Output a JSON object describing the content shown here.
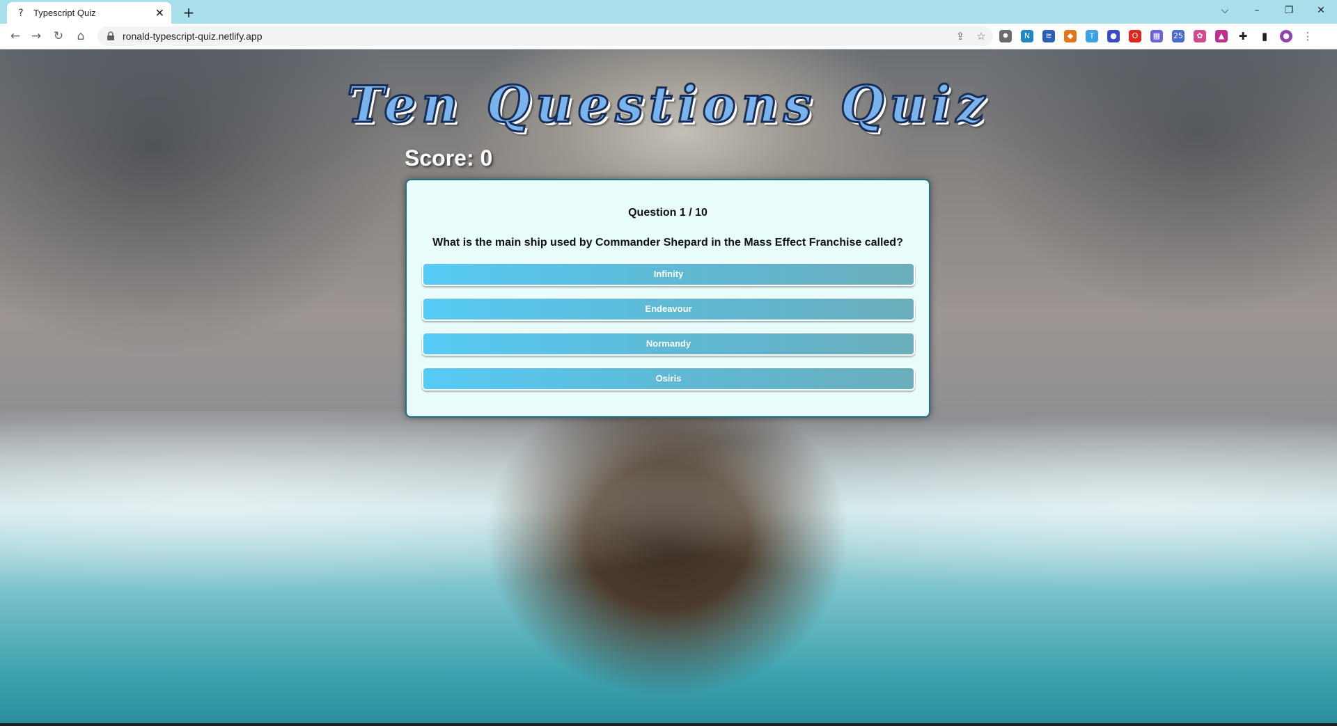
{
  "browser": {
    "tab_title": "Typescript Quiz",
    "tab_favicon": "?",
    "new_tab_label": "+",
    "url": "ronald-typescript-quiz.netlify.app",
    "window_controls": {
      "tab_search": "⌵",
      "minimize": "–",
      "restore": "❐",
      "close": "✕"
    },
    "extensions": [
      {
        "name": "bug-extension-icon",
        "color": "#6b6b6b",
        "glyph": "✹"
      },
      {
        "name": "n-extension-icon",
        "color": "#1e88c7",
        "glyph": "N"
      },
      {
        "name": "layers-extension-icon",
        "color": "#2b5fb8",
        "glyph": "≋"
      },
      {
        "name": "fox-extension-icon",
        "color": "#e2761b",
        "glyph": "◆"
      },
      {
        "name": "t-extension-icon",
        "color": "#3aa0e8",
        "glyph": "T"
      },
      {
        "name": "circle-extension-icon",
        "color": "#3c4cc7",
        "glyph": "●"
      },
      {
        "name": "opera-extension-icon",
        "color": "#e0271c",
        "glyph": "O"
      },
      {
        "name": "grid-extension-icon",
        "color": "#6c63d6",
        "glyph": "▦"
      },
      {
        "name": "calendar-extension-icon",
        "color": "#4a6ad8",
        "glyph": "25"
      },
      {
        "name": "swirl-extension-icon",
        "color": "#d24a8c",
        "glyph": "✿"
      },
      {
        "name": "triangle-extension-icon",
        "color": "#c0308a",
        "glyph": "▲"
      },
      {
        "name": "puzzle-extension-icon",
        "color": "#202124",
        "glyph": "✚"
      },
      {
        "name": "sidepanel-icon",
        "color": "#202124",
        "glyph": "▮"
      },
      {
        "name": "profile-avatar-icon",
        "color": "#8e44ad",
        "glyph": "●"
      },
      {
        "name": "menu-kebab-icon",
        "color": "#5f6368",
        "glyph": "⋮"
      }
    ]
  },
  "quiz": {
    "title": "Ten Questions Quiz",
    "score_label": "Score: 0",
    "question_number": "Question 1 / 10",
    "question_text": "What is the main ship used by Commander Shepard in the Mass Effect Franchise called?",
    "answers": [
      "Infinity",
      "Endeavour",
      "Normandy",
      "Osiris"
    ]
  }
}
